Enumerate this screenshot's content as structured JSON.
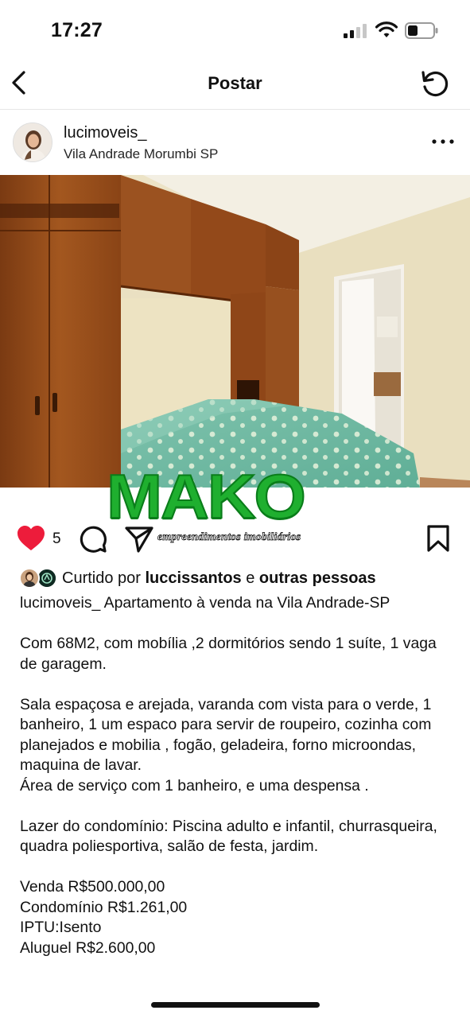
{
  "status_bar": {
    "time": "17:27"
  },
  "nav": {
    "title": "Postar"
  },
  "post": {
    "username": "lucimoveis_",
    "location": "Vila Andrade Morumbi SP",
    "like_count": "5",
    "watermark": {
      "logo": "MAKO",
      "tagline": "empreendimentos imobiliários"
    },
    "liked_by": {
      "prefix": "Curtido por",
      "user": "luccissantos",
      "joiner": "e",
      "others": "outras pessoas"
    },
    "caption": {
      "username": "lucimoveis_",
      "headline": "Apartamento à venda na Vila Andrade-SP",
      "paragraphs": [
        "Com 68M2, com mobília ,2 dormitórios sendo 1 suíte, 1 vaga de garagem.",
        "Sala espaçosa e arejada, varanda com vista para o verde, 1 banheiro, 1 um espaco para servir de roupeiro, cozinha com  planejados e mobilia , fogão, geladeira, forno microondas, maquina de lavar.\nÁrea de serviço com 1 banheiro, e uma despensa .",
        "Lazer do condomínio: Piscina adulto e infantil, churrasqueira, quadra poliesportiva, salão de festa, jardim.",
        "Venda R$500.000,00\nCondomínio R$1.261,00\nIPTU:Isento\nAluguel R$2.600,00"
      ]
    }
  },
  "colors": {
    "like_red": "#ed1c3b",
    "watermark_green": "#1faf2f",
    "text": "#111111"
  },
  "icons": {
    "back": "chevron-left-icon",
    "refresh": "refresh-icon",
    "more": "more-horizontal-icon",
    "like": "heart-icon",
    "comment": "comment-icon",
    "share": "send-icon",
    "save": "bookmark-icon"
  }
}
